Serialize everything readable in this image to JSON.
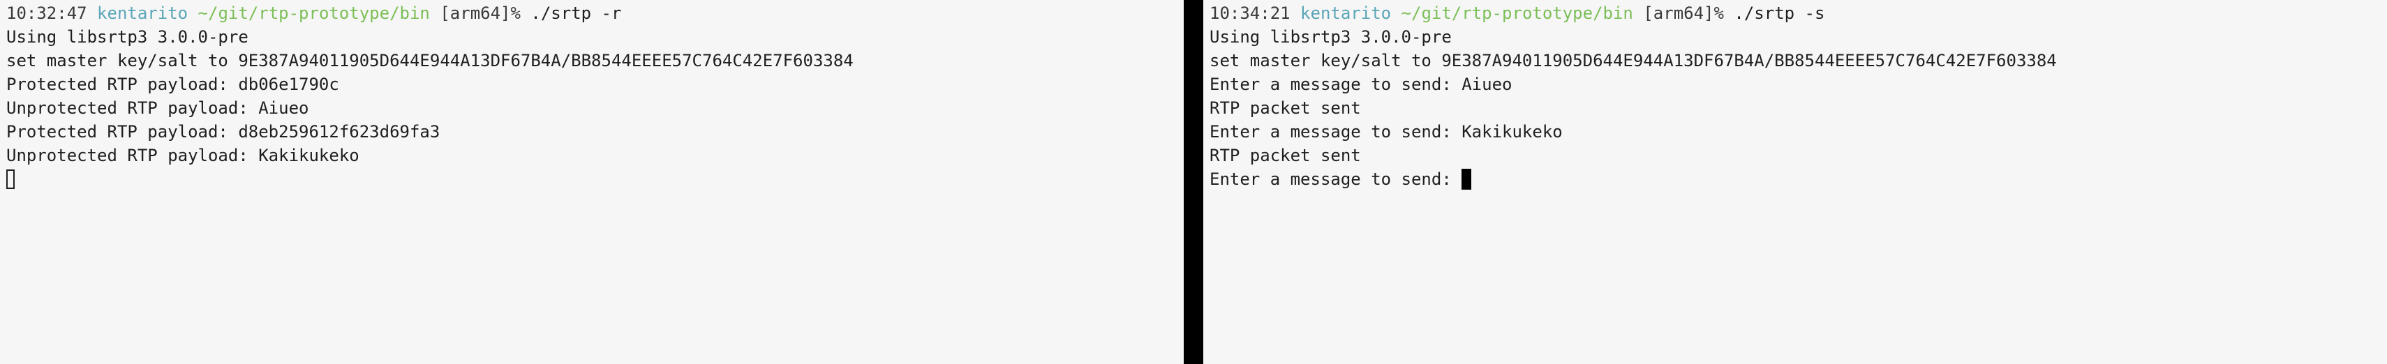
{
  "left_terminal": {
    "prompt": {
      "time": "10:32:47",
      "user": "kentarito",
      "path": "~/git/rtp-prototype/bin",
      "arch": "[arm64]%",
      "command": "./srtp -r"
    },
    "output": [
      "Using libsrtp3 3.0.0-pre",
      "set master key/salt to 9E387A94011905D644E944A13DF67B4A/BB8544EEEE57C764C42E7F603384",
      "Protected RTP payload: db06e1790c",
      "Unprotected RTP payload: Aiueo",
      "Protected RTP payload: d8eb259612f623d69fa3",
      "Unprotected RTP payload: Kakikukeko"
    ]
  },
  "right_terminal": {
    "prompt": {
      "time": "10:34:21",
      "user": "kentarito",
      "path": "~/git/rtp-prototype/bin",
      "arch": "[arm64]%",
      "command": "./srtp -s"
    },
    "output": [
      "Using libsrtp3 3.0.0-pre",
      "set master key/salt to 9E387A94011905D644E944A13DF67B4A/BB8544EEEE57C764C42E7F603384",
      "Enter a message to send: Aiueo",
      "RTP packet sent",
      "Enter a message to send: Kakikukeko",
      "RTP packet sent"
    ],
    "current_input_prompt": "Enter a message to send: "
  }
}
